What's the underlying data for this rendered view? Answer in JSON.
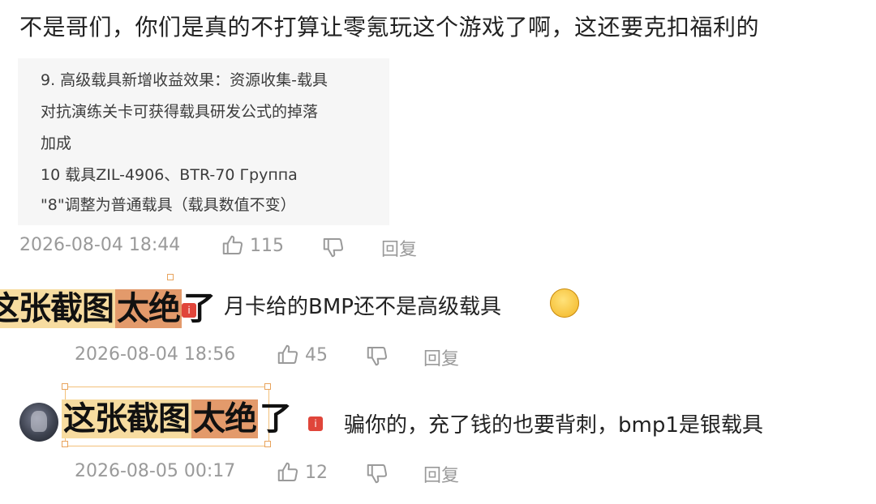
{
  "main_comment": {
    "text": "不是哥们，你们是真的不打算让零氪玩这个游戏了啊，这还要克扣福利的",
    "quote_lines": [
      "9. 高级载具新增收益效果：资源收集-载具",
      "对抗演练关卡可获得载具研发公式的掉落",
      "加成",
      "10 载具ZIL-4906、BTR-70 Группа",
      "\"8\"调整为普通载具（载具数值不变）"
    ],
    "timestamp": "2026-08-04 18:44",
    "likes": "115",
    "reply_label": "回复"
  },
  "replies": [
    {
      "text": "月卡给的BMP还不是高级载具",
      "timestamp": "2026-08-04 18:56",
      "likes": "45",
      "reply_label": "回复"
    },
    {
      "text": "骗你的，充了钱的也要背刺，bmp1是银载具",
      "timestamp": "2026-08-05 00:17",
      "likes": "12",
      "reply_label": "回复"
    }
  ],
  "captions": [
    {
      "part1": "这张截图",
      "part2": "太绝",
      "part3": "了"
    },
    {
      "part1": "这张截图",
      "part2": "太绝",
      "part3": "了"
    }
  ],
  "badge_text": "i",
  "colors": {
    "caption_light": "#f7dca0",
    "caption_highlight": "#e39a6b",
    "meta_gray": "#9a9a9a"
  },
  "icons": [
    "thumbs-up-icon",
    "thumbs-down-icon",
    "laughing-emoji-icon"
  ]
}
